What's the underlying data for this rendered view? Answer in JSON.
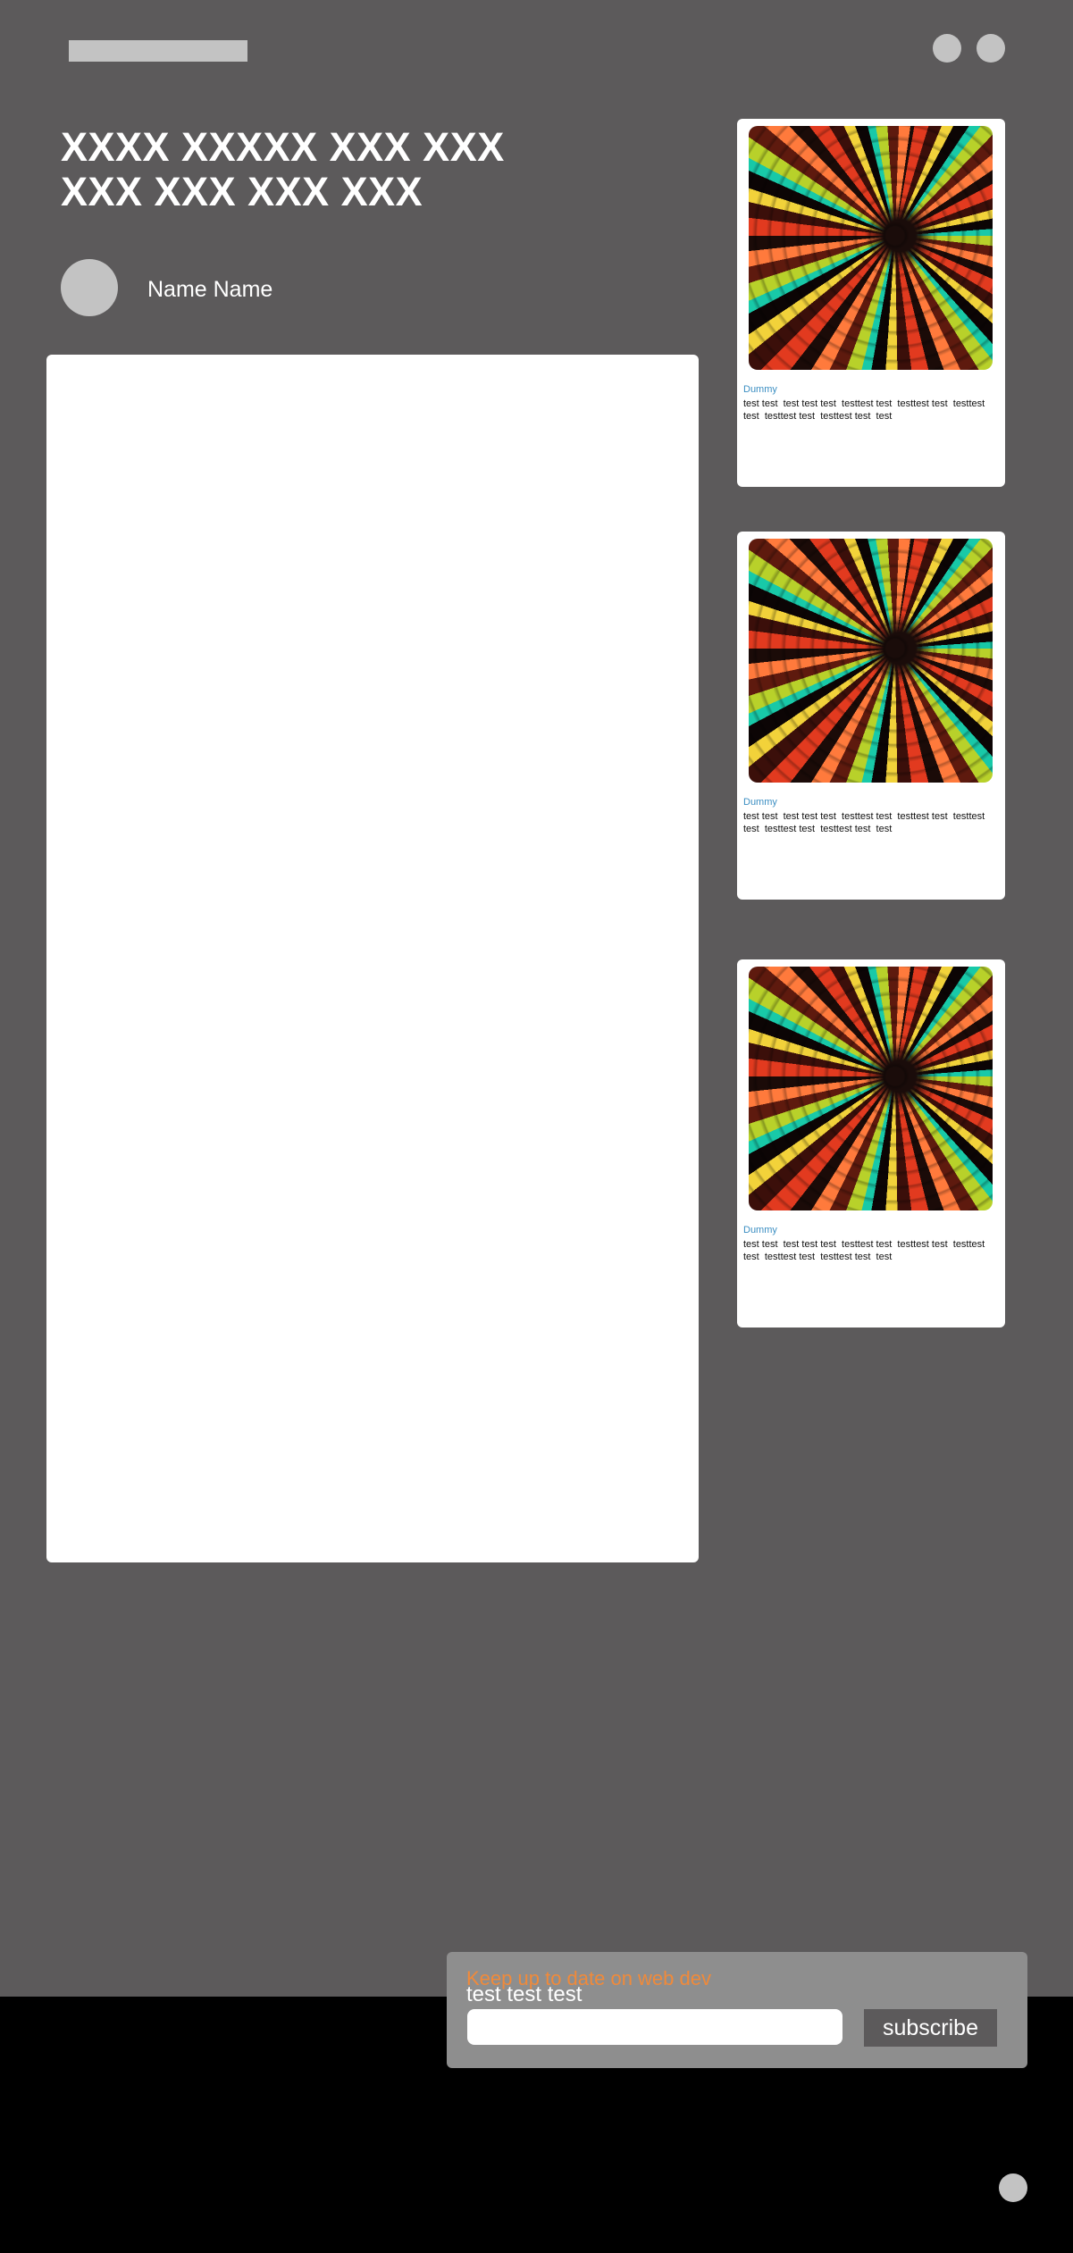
{
  "header": {
    "logo_placeholder": "logo",
    "icons": [
      "circle-icon",
      "circle-icon"
    ]
  },
  "article": {
    "headline": "XXXX  XXXXX XXX XXX\nXXX XXX XXX XXX",
    "author_name": "Name Name"
  },
  "cards": [
    {
      "tag": "Dummy",
      "text": "test test  test test test  testtest test  testtest test  testtest test  testtest test  testtest test  test"
    },
    {
      "tag": "Dummy",
      "text": "test test  test test test  testtest test  testtest test  testtest test  testtest test  testtest test  test"
    },
    {
      "tag": "Dummy",
      "text": "test test  test test test  testtest test  testtest test  testtest test  testtest test  testtest test  test"
    }
  ],
  "subscribe": {
    "heading": "Keep up to date on web dev",
    "subheading": "test test test",
    "input_value": "",
    "button_label": "subscribe"
  },
  "colors": {
    "page_background": "#5c5a5b",
    "footer_background": "#000000",
    "accent_orange": "#f08a3a",
    "tag_blue": "#3b8ec2",
    "placeholder_gray": "#c3c3c3"
  }
}
